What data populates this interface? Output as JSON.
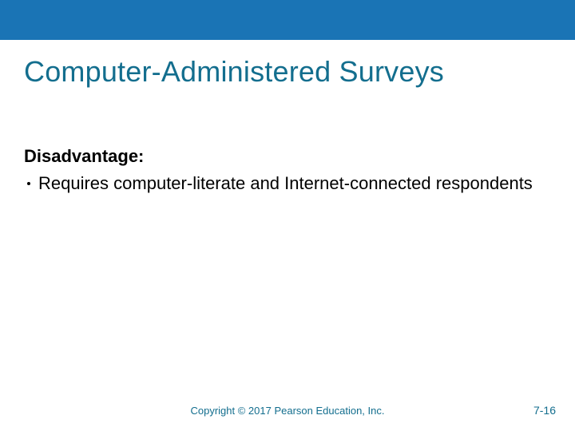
{
  "colors": {
    "topbar": "#1a74b5",
    "accent": "#136e8e"
  },
  "title": "Computer-Administered Surveys",
  "subhead": "Disadvantage:",
  "bullets": [
    "Requires computer-literate and Internet-connected respondents"
  ],
  "footer": {
    "copyright": "Copyright © 2017 Pearson Education, Inc.",
    "page": "7-16"
  }
}
